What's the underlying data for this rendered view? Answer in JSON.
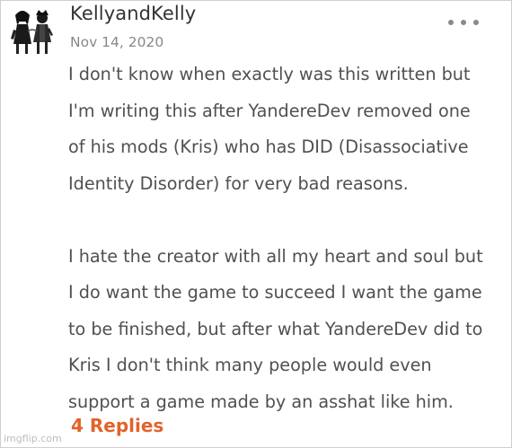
{
  "comment": {
    "username": "KellyandKelly",
    "date": "Nov 14, 2020",
    "more_icon": "more-dots-icon",
    "lines_paragraph_1": [
      "I don't know when exactly was this written but",
      "I'm writing this after  YandereDev removed one",
      "of his mods (Kris) who has DID (Disassociative",
      "Identity Disorder) for very bad reasons."
    ],
    "lines_paragraph_2": [
      "I hate the creator with all my heart and soul but",
      "I do want the game to succeed I want the game",
      "to be finished, but after what YandereDev did to",
      "Kris I don't think many people would even",
      "support a game made by an asshat like him."
    ],
    "replies_label": "4 Replies"
  },
  "watermark": "imgflip.com",
  "colors": {
    "accent": "#e2632b",
    "username": "#333333",
    "body_text": "#505050",
    "meta_text": "#888888"
  }
}
